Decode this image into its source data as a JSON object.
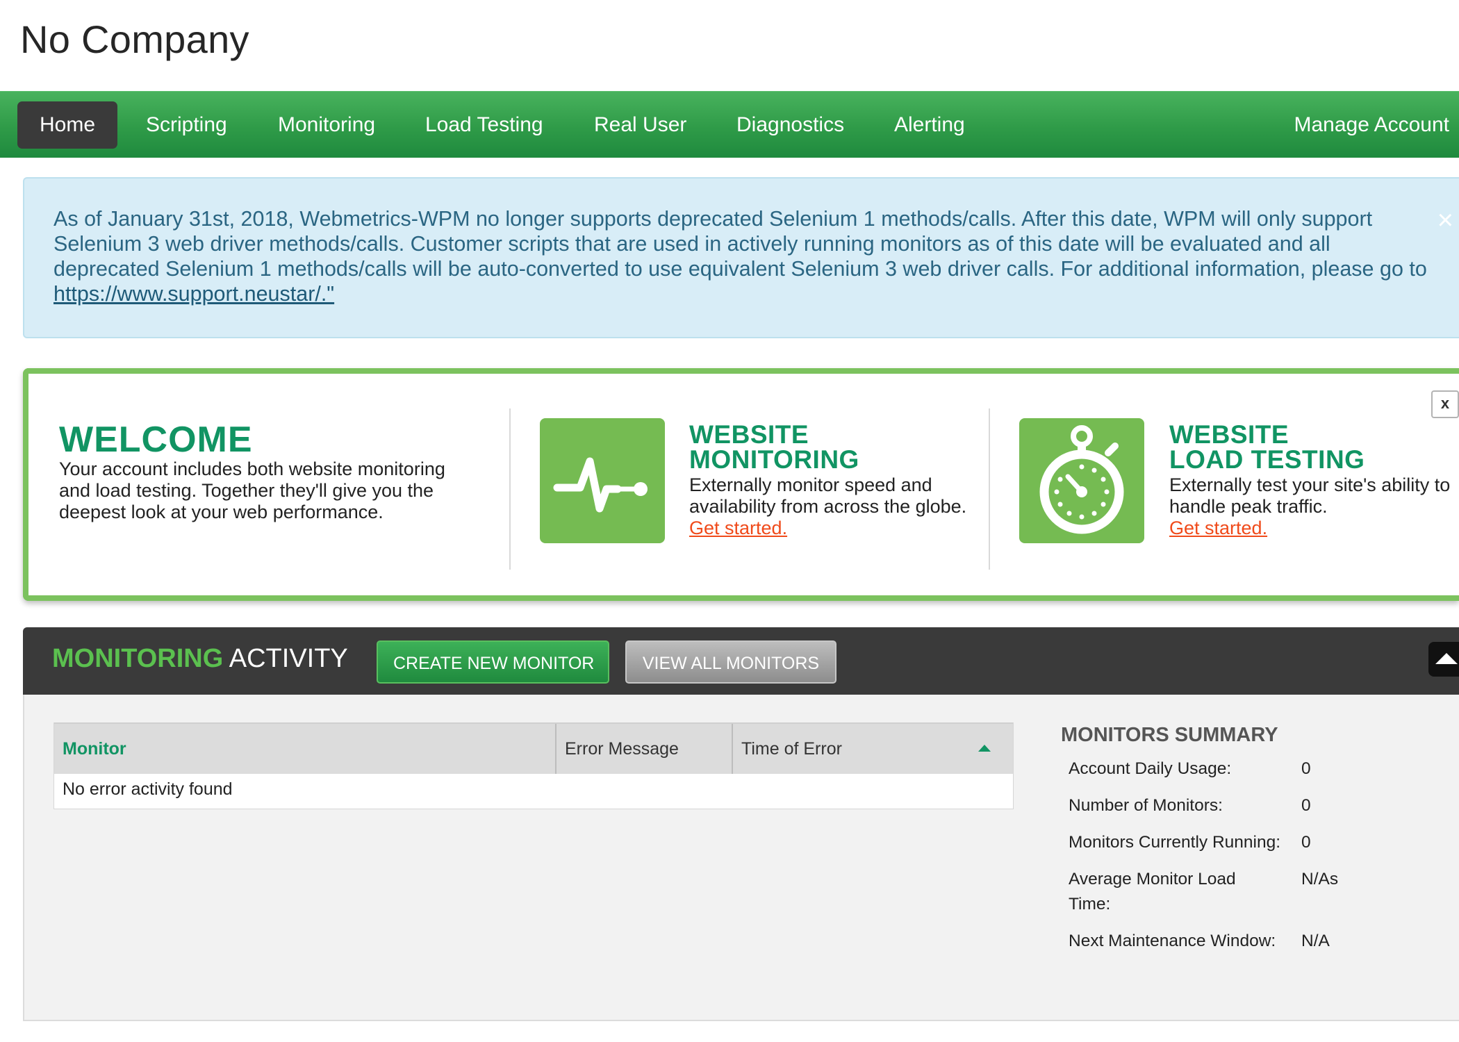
{
  "company": "No Company",
  "nav": {
    "items": [
      "Home",
      "Scripting",
      "Monitoring",
      "Load Testing",
      "Real User",
      "Diagnostics",
      "Alerting"
    ],
    "active": "Home",
    "account": "Manage Account"
  },
  "alert": {
    "text": "As of January 31st, 2018, Webmetrics-WPM no longer supports deprecated Selenium 1 methods/calls. After this date, WPM will only support Selenium 3 web driver methods/calls. Customer scripts that are used in actively running monitors as of this date will be evaluated and all deprecated Selenium 1 methods/calls will be auto-converted to use equivalent Selenium 3 web driver calls. For additional information, please go to ",
    "link": "https://www.support.neustar/.\"",
    "close": "×"
  },
  "welcome": {
    "title": "WELCOME",
    "body": "Your account includes both website monitoring and load testing. Together they'll give you the deepest look at your web performance.",
    "close": "x",
    "monitoring": {
      "title_line1": "WEBSITE",
      "title_line2": "MONITORING",
      "body": "Externally monitor speed and availability from across the globe. ",
      "link": "Get started.",
      "icon": "pulse-icon"
    },
    "loadtesting": {
      "title_line1": "WEBSITE",
      "title_line2": "LOAD TESTING",
      "body": "Externally test your site's ability to handle peak traffic.",
      "link": "Get started.",
      "icon": "stopwatch-icon"
    }
  },
  "activity": {
    "title_green": "MONITORING",
    "title_white": " ACTIVITY",
    "create_button": "CREATE NEW MONITOR",
    "view_button": "VIEW ALL MONITORS",
    "table": {
      "columns": [
        "Monitor",
        "Error Message",
        "Time of Error"
      ],
      "empty": "No error activity found"
    },
    "summary": {
      "title": "MONITORS SUMMARY",
      "rows": [
        {
          "label": "Account Daily Usage:",
          "value": "0"
        },
        {
          "label": "Number of Monitors:",
          "value": "0"
        },
        {
          "label": "Monitors Currently Running:",
          "value": "0"
        },
        {
          "label": "Average Monitor Load Time:",
          "value": "N/As"
        },
        {
          "label": "Next Maintenance Window:",
          "value": "N/A"
        }
      ]
    }
  },
  "colors": {
    "nav_green": "#2f9b48",
    "brand_green": "#119463",
    "icon_green": "#75bb52",
    "link_orange": "#f04a1a",
    "alert_bg": "#d8edf7"
  }
}
